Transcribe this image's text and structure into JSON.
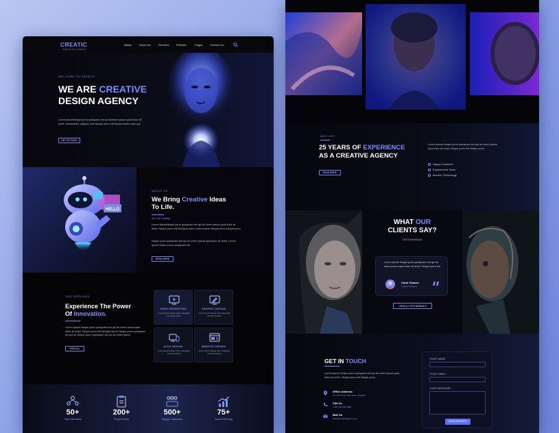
{
  "left_page": {
    "nav": {
      "logo": "CREATIC",
      "logo_sub": "CREATIVE AGENCY",
      "items": [
        "Home",
        "About Us",
        "Services",
        "Portfolio",
        "Pages",
        "Contact Us"
      ]
    },
    "hero": {
      "eyebrow": "WELCOME TO CREATIC",
      "title_line1_a": "WE ARE ",
      "title_line1_b": "CREATIVE",
      "title_line2": "DESIGN AGENCY",
      "body": "Lorem ipsumNeque porro quisquam est qui dolorem ipsum quia dolor sit amet, consectetur, adipisci velit Neque porro elit Neque dolore quis quo",
      "button": "GET IN TOUCH"
    },
    "about": {
      "eyebrow": "ABOUT US",
      "title_a": "We Bring ",
      "title_b": "Creative",
      "title_c": " Ideas",
      "title_line2": "To Life.",
      "sublabel": "We Love Creating",
      "para1": "Lorem ipsumNeque porro quisquam est qui do lorem ipsum quia dolor sit amet. Neque porro elit NeQque porro Lorem ipsum Neque porro Neque porro",
      "para2": "Neque porro quisquam est qui do lorem ipsum quia dolor sit amet. Lorem ipsum Neque porro quisquam est",
      "button": "READ MORE",
      "robot_sign": "HELLO"
    },
    "services": {
      "eyebrow": "OUR SERVICES",
      "title_line1": "Experience The Power",
      "title_line2_a": "Of ",
      "title_line2_b": "Innovation.",
      "body": "Lorem ipsum Neque porro quisquam est qui do lorem ipsum quia dolor sit amet. Neque porro elit NeQque porro Neque porro quisquam est qui do Neque porro quisquam est qui do lorem ipsum",
      "button": "VIEW ALL",
      "cards": [
        {
          "title": "VIDEO MARKETING",
          "desc": "Lorem ipsum Neque porro quisquam est qui do quam",
          "icon": "video-icon"
        },
        {
          "title": "GRAPHIC DESIGN",
          "desc": "Lorem ipsum Neque porro quisquam est qui do quam",
          "icon": "pen-tool-icon"
        },
        {
          "title": "UI/UX DESIGN",
          "desc": "Lorem ipsum Neque porro quisquam est qui do quam",
          "icon": "devices-icon"
        },
        {
          "title": "WEBSITE DESIGN",
          "desc": "Lorem ipsum Neque porro quisquam est qui do quam",
          "icon": "browser-icon"
        }
      ]
    },
    "stats": [
      {
        "value": "50+",
        "label": "Team Members",
        "icon": "team-icon"
      },
      {
        "value": "200+",
        "label": "Project Done",
        "icon": "clipboard-icon"
      },
      {
        "value": "500+",
        "label": "Happy Customers",
        "icon": "customers-icon"
      },
      {
        "value": "75+",
        "label": "Award Winning",
        "icon": "growth-chart-icon"
      }
    ]
  },
  "right_page": {
    "why": {
      "eyebrow": "WHY US?",
      "title_a": "25 YEARS OF ",
      "title_b": "EXPERIENCE",
      "title_line2": "AS A CREATIVE AGENCY",
      "button": "READ MORE",
      "body": "Lorem ipsum Neque porro quisquam est qui do lorem ipsum quia dolor sit amet. Neque porro elit Neque porro",
      "list": [
        "Happy Customer",
        "Experienced Team",
        "Modern Technology"
      ]
    },
    "testimonials": {
      "title_a": "WHAT ",
      "title_b": "OUR",
      "title_line2": "CLIENTS SAY?",
      "eyebrow": "TESTIMONIALS",
      "quote": "Lorem ipsum Neque porro quisquam est qui do lorem ipsum quia dolor sit amet. Neque porro elit",
      "author": "Carol Chaves",
      "author_role": "Graphic Designer",
      "button": "VIEW ALL TESTIMONIALS"
    },
    "contact": {
      "title_a": "GET IN ",
      "title_b": "TOUCH",
      "body": "Lorem ipsum Neque porro quisquam est qui do lorem ipsum quia dolor sit amet. Neque porro elit Neque porro",
      "items": [
        {
          "title": "Office Address:",
          "text": "45, Gol St, My City, State, Australia",
          "icon": "location-pin-icon"
        },
        {
          "title": "Call Us",
          "text": "(+00) 123 456 7890",
          "icon": "phone-icon"
        },
        {
          "title": "Mail Us",
          "text": "Hello@creaticagency.com",
          "icon": "mail-icon"
        }
      ],
      "form": {
        "name_label": "YOUR NAME",
        "email_label": "YOUR EMAIL",
        "message_label": "YOUR MESSAGE",
        "button": "SEND MESSAGE"
      }
    }
  },
  "colors": {
    "accent": "#7d8dff",
    "background": "#050509",
    "page_backdrop": "#8da2e6"
  }
}
